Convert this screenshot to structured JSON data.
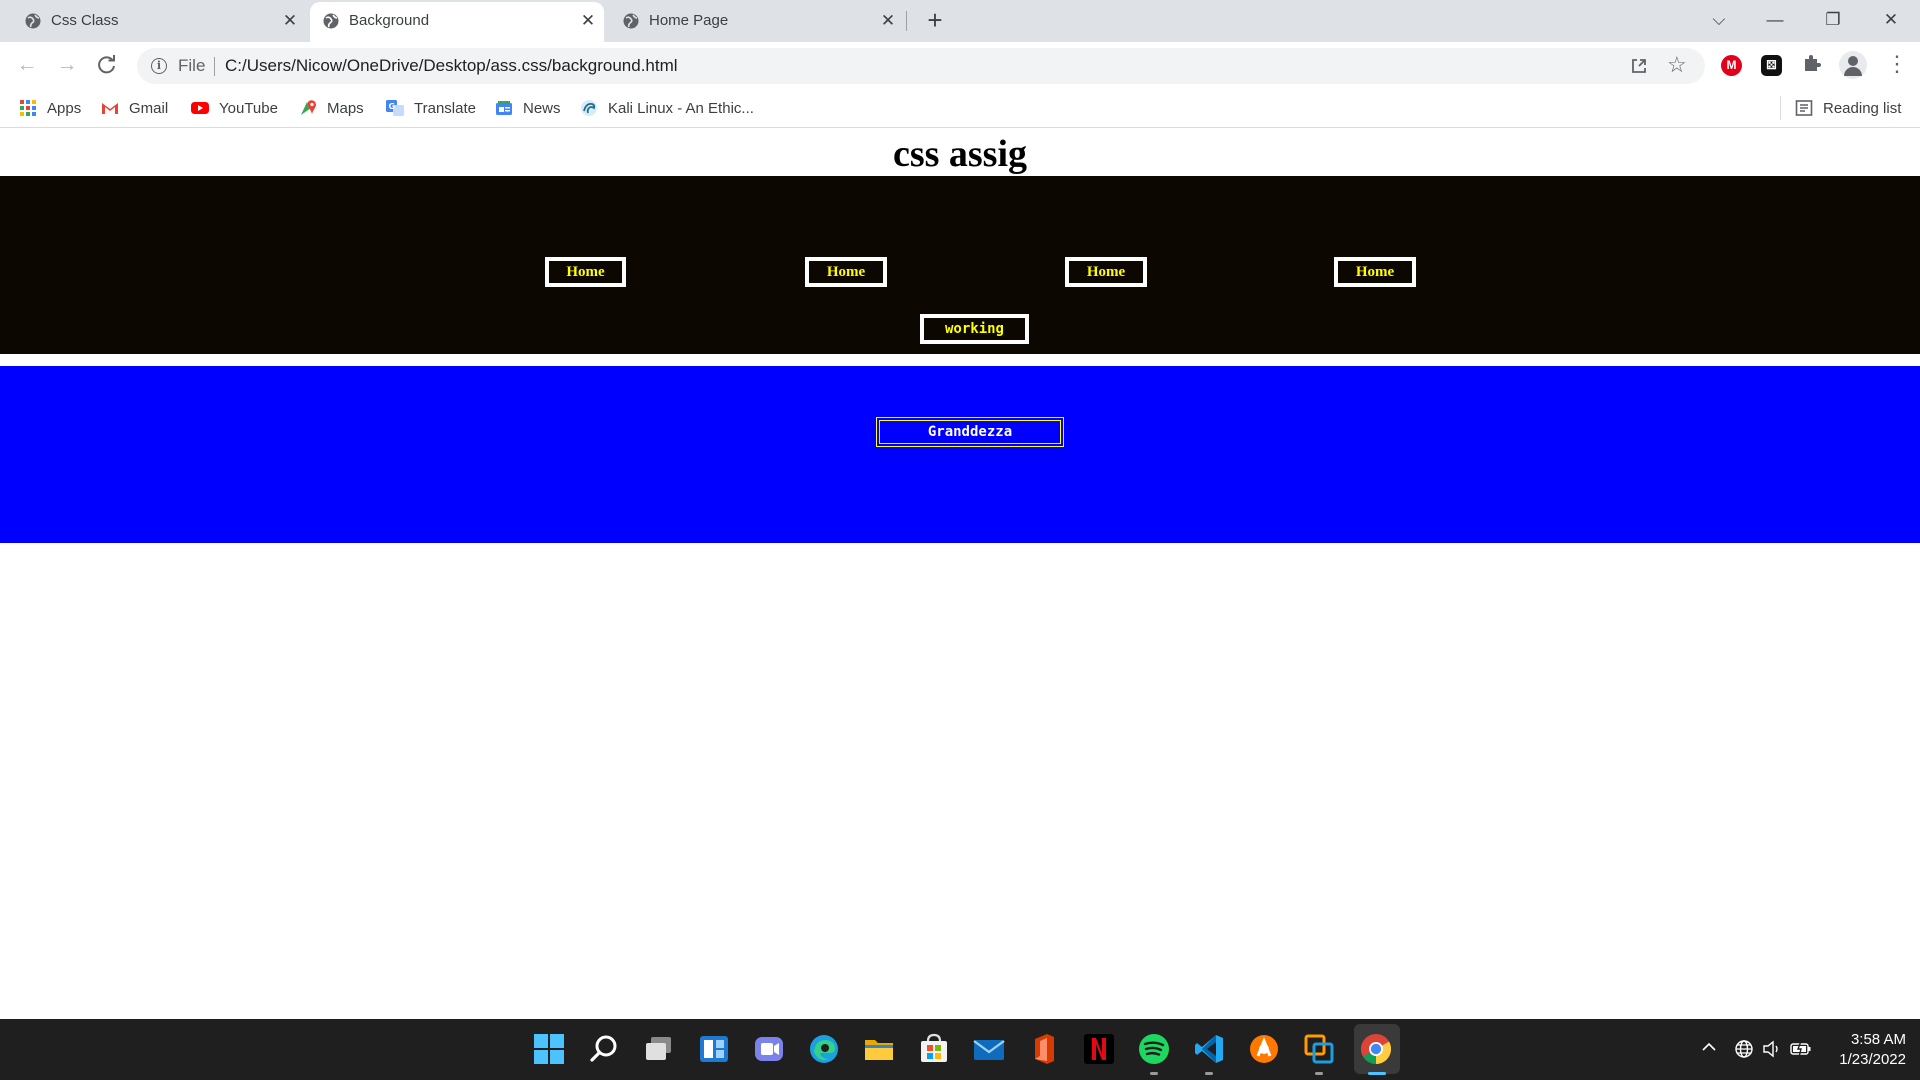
{
  "browser": {
    "tabs": [
      {
        "title": "Css Class",
        "active": false
      },
      {
        "title": "Background",
        "active": true
      },
      {
        "title": "Home Page",
        "active": false
      }
    ],
    "close_glyph": "✕",
    "new_tab_glyph": "+",
    "window_controls": {
      "tab_search": "⌵",
      "minimize": "—",
      "maximize": "❐",
      "close": "✕"
    },
    "address": {
      "scheme_label": "File",
      "url": "C:/Users/Nicow/OneDrive/Desktop/ass.css/background.html"
    },
    "extensions": {
      "mega_label": "M",
      "dice_label": "⚄"
    },
    "bookmarks": [
      "Apps",
      "Gmail",
      "YouTube",
      "Maps",
      "Translate",
      "News",
      "Kali Linux - An Ethic..."
    ],
    "reading_list": "Reading list"
  },
  "page": {
    "title": "css assig",
    "nav_links": [
      "Home",
      "Home",
      "Home",
      "Home"
    ],
    "working_link": "working",
    "grand_button": "Granddezza",
    "colors": {
      "black_band": "#0c0700",
      "blue_band": "#0000ff",
      "link_text": "#ffff00",
      "link_border": "#ffffff"
    }
  },
  "taskbar": {
    "apps": [
      "start",
      "search",
      "task-view",
      "widgets",
      "teams-chat",
      "edge",
      "file-explorer",
      "microsoft-store",
      "mail",
      "office",
      "netflix",
      "spotify",
      "vs-code",
      "avast",
      "vmware",
      "chrome"
    ],
    "clock_time": "3:58 AM",
    "clock_date": "1/23/2022",
    "tray_chevron": "^"
  }
}
